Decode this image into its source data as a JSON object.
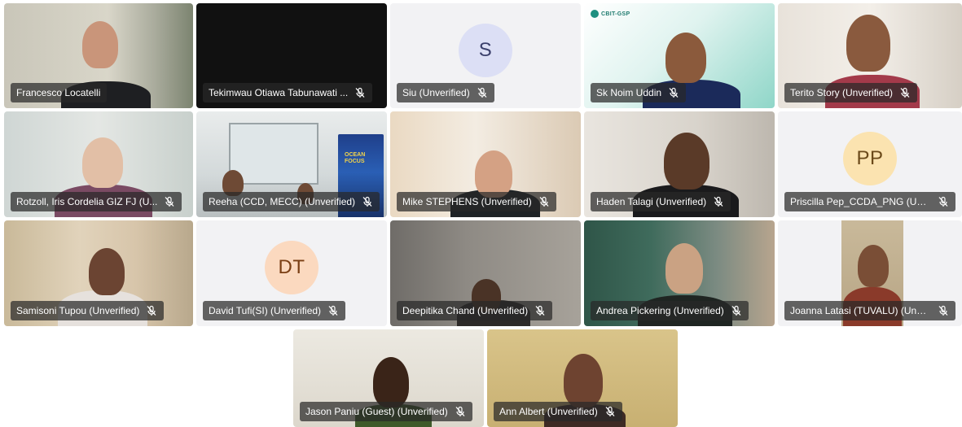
{
  "meeting": {
    "row1": [
      {
        "id": "t1",
        "name": "Francesco Locatelli",
        "muted": false
      },
      {
        "id": "t2",
        "name": "Tekimwau Otiawa Tabunawati ...",
        "muted": true
      },
      {
        "id": "t3",
        "name": "Siu (Unverified)",
        "muted": true,
        "initials": "S"
      },
      {
        "id": "t4",
        "name": "Sk Noim Uddin",
        "muted": true,
        "logo": "CBIT-GSP"
      },
      {
        "id": "t5",
        "name": "Terito Story (Unverified)",
        "muted": true
      }
    ],
    "row2": [
      {
        "id": "t6",
        "name": "Rotzoll, Iris Cordelia GIZ FJ (U...",
        "muted": true
      },
      {
        "id": "t7",
        "name": "Reeha (CCD, MECC) (Unverified)",
        "muted": true,
        "poster": "OCEAN FOCUS"
      },
      {
        "id": "t8",
        "name": "Mike STEPHENS (Unverified)",
        "muted": true
      },
      {
        "id": "t9",
        "name": "Haden Talagi (Unverified)",
        "muted": true
      },
      {
        "id": "t10",
        "name": "Priscilla Pep_CCDA_PNG (Unv...",
        "muted": true,
        "initials": "PP"
      }
    ],
    "row3": [
      {
        "id": "t11",
        "name": "Samisoni Tupou (Unverified)",
        "muted": true
      },
      {
        "id": "t12",
        "name": "David Tufi(SI) (Unverified)",
        "muted": true,
        "initials": "DT"
      },
      {
        "id": "t13",
        "name": "Deepitika Chand (Unverified)",
        "muted": true
      },
      {
        "id": "t14",
        "name": "Andrea Pickering (Unverified)",
        "muted": true
      },
      {
        "id": "t15",
        "name": "Joanna Latasi (TUVALU) (Unve...",
        "muted": true
      }
    ],
    "row4": [
      {
        "id": "t16",
        "name": "Jason Paniu (Guest) (Unverified)",
        "muted": true
      },
      {
        "id": "t17",
        "name": "Ann Albert (Unverified)",
        "muted": true
      }
    ]
  },
  "colors": {
    "label_bg": "#282828",
    "avatar_s": "#dcdff5",
    "avatar_pp": "#fbe3b0",
    "avatar_dt": "#fbd9bf"
  }
}
